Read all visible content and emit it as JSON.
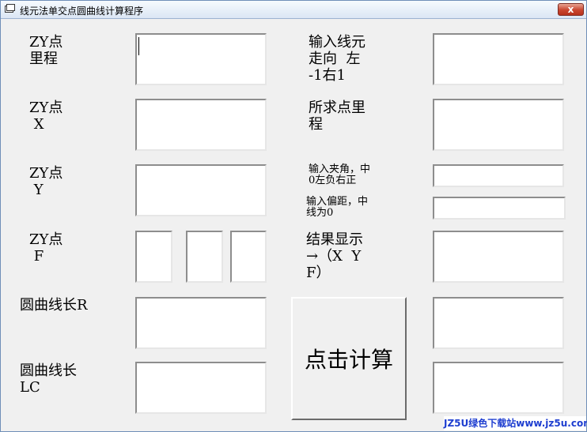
{
  "window": {
    "title": "线元法单交点圆曲线计算程序",
    "close_label": "x"
  },
  "labels": {
    "zy_mileage": "ZY点\n里程",
    "zy_x": "ZY点\n X",
    "zy_y": "ZY点\n Y",
    "zy_f": "ZY点\n F",
    "arc_r": "圆曲线长R",
    "arc_lc": "圆曲线长\nLC",
    "direction": "输入线元\n走向  左\n-1右1",
    "target_mileage": "所求点里\n程",
    "angle": "输入夹角，中\n0左负右正",
    "offset": "输入偏距，中\n线为0",
    "result": "结果显示\n→（X  Y\nF）"
  },
  "button": {
    "calculate": "点击计算"
  },
  "watermark": "JZ5U绿色下载站www.jz5u.com",
  "fields": {
    "zy_mileage": "",
    "zy_x": "",
    "zy_y": "",
    "zy_f_deg": "",
    "zy_f_min": "",
    "zy_f_sec": "",
    "arc_r": "",
    "arc_lc": "",
    "direction": "",
    "target_mileage": "",
    "angle": "",
    "offset": "",
    "result_x": "",
    "result_y": "",
    "result_f": ""
  }
}
